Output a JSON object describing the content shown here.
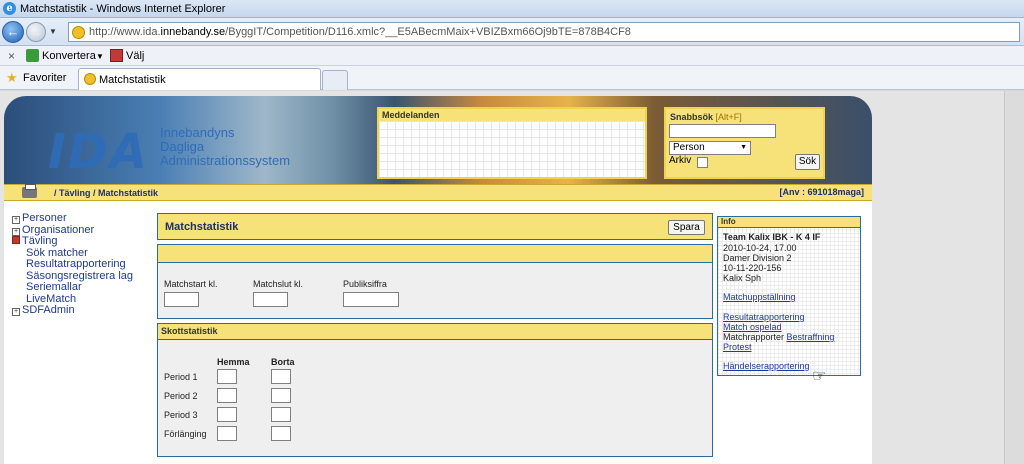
{
  "browser": {
    "window_title": "Matchstatistik - Windows Internet Explorer",
    "url_prefix": "http://www.ida.",
    "url_domain": "innebandy.se",
    "url_path": "/ByggIT/Competition/D116.xmlc?__E5ABecmMaix+VBIZBxm66Oj9bTE=878B4CF8",
    "cmd_convert": "Konvertera",
    "cmd_select": "Välj",
    "favorites": "Favoriter",
    "tab_title": "Matchstatistik"
  },
  "banner": {
    "logo": "IDA",
    "logo_sub_1": "Innebandyns",
    "logo_sub_2": "Dagliga",
    "logo_sub_3": "Administrationssystem",
    "messages_title": "Meddelanden",
    "quicksearch_title": "Snabbsök",
    "quicksearch_hotkey": "[Alt+F]",
    "quicksearch_type": "Person",
    "archive_label": "Arkiv",
    "search_button": "Sök"
  },
  "crumbbar": {
    "breadcrumb": "/ Tävling / Matchstatistik",
    "user": "[Anv : 691018maga]"
  },
  "menu": [
    {
      "label": "Personer",
      "level": 0,
      "box": "+"
    },
    {
      "label": "Organisationer",
      "level": 0,
      "box": "+"
    },
    {
      "label": "Tävling",
      "level": 0,
      "box": "open"
    },
    {
      "label": "Sök matcher",
      "level": 1
    },
    {
      "label": "Resultatrapportering",
      "level": 1
    },
    {
      "label": "Säsongsregistrera lag",
      "level": 1
    },
    {
      "label": "Seriemallar",
      "level": 1
    },
    {
      "label": "LiveMatch",
      "level": 1
    },
    {
      "label": "SDFAdmin",
      "level": 0,
      "box": "+"
    }
  ],
  "main": {
    "title": "Matchstatistik",
    "save_button": "Spara",
    "match_start_label": "Matchstart kl.",
    "match_end_label": "Matchslut kl.",
    "audience_label": "Publiksiffra",
    "shots_title": "Skottstatistik",
    "home_label": "Hemma",
    "away_label": "Borta",
    "periods": [
      "Period 1",
      "Period 2",
      "Period 3",
      "Förlänging"
    ]
  },
  "info": {
    "title": "Info",
    "team": "Team Kalix IBK - K 4 IF",
    "datetime": "2010-10-24, 17.00",
    "division": "Damer Division 2",
    "match_id": "10-11-220-156",
    "venue": "Kalix Sph",
    "link_lineup": "Matchuppställning",
    "link_results": "Resultatrapportering",
    "link_unplayed": "Match ospelad",
    "match_reports_text": "Matchrapporter",
    "link_penalty": "Bestraffning",
    "link_protest": "Protest",
    "link_events": "Händelserapportering"
  }
}
